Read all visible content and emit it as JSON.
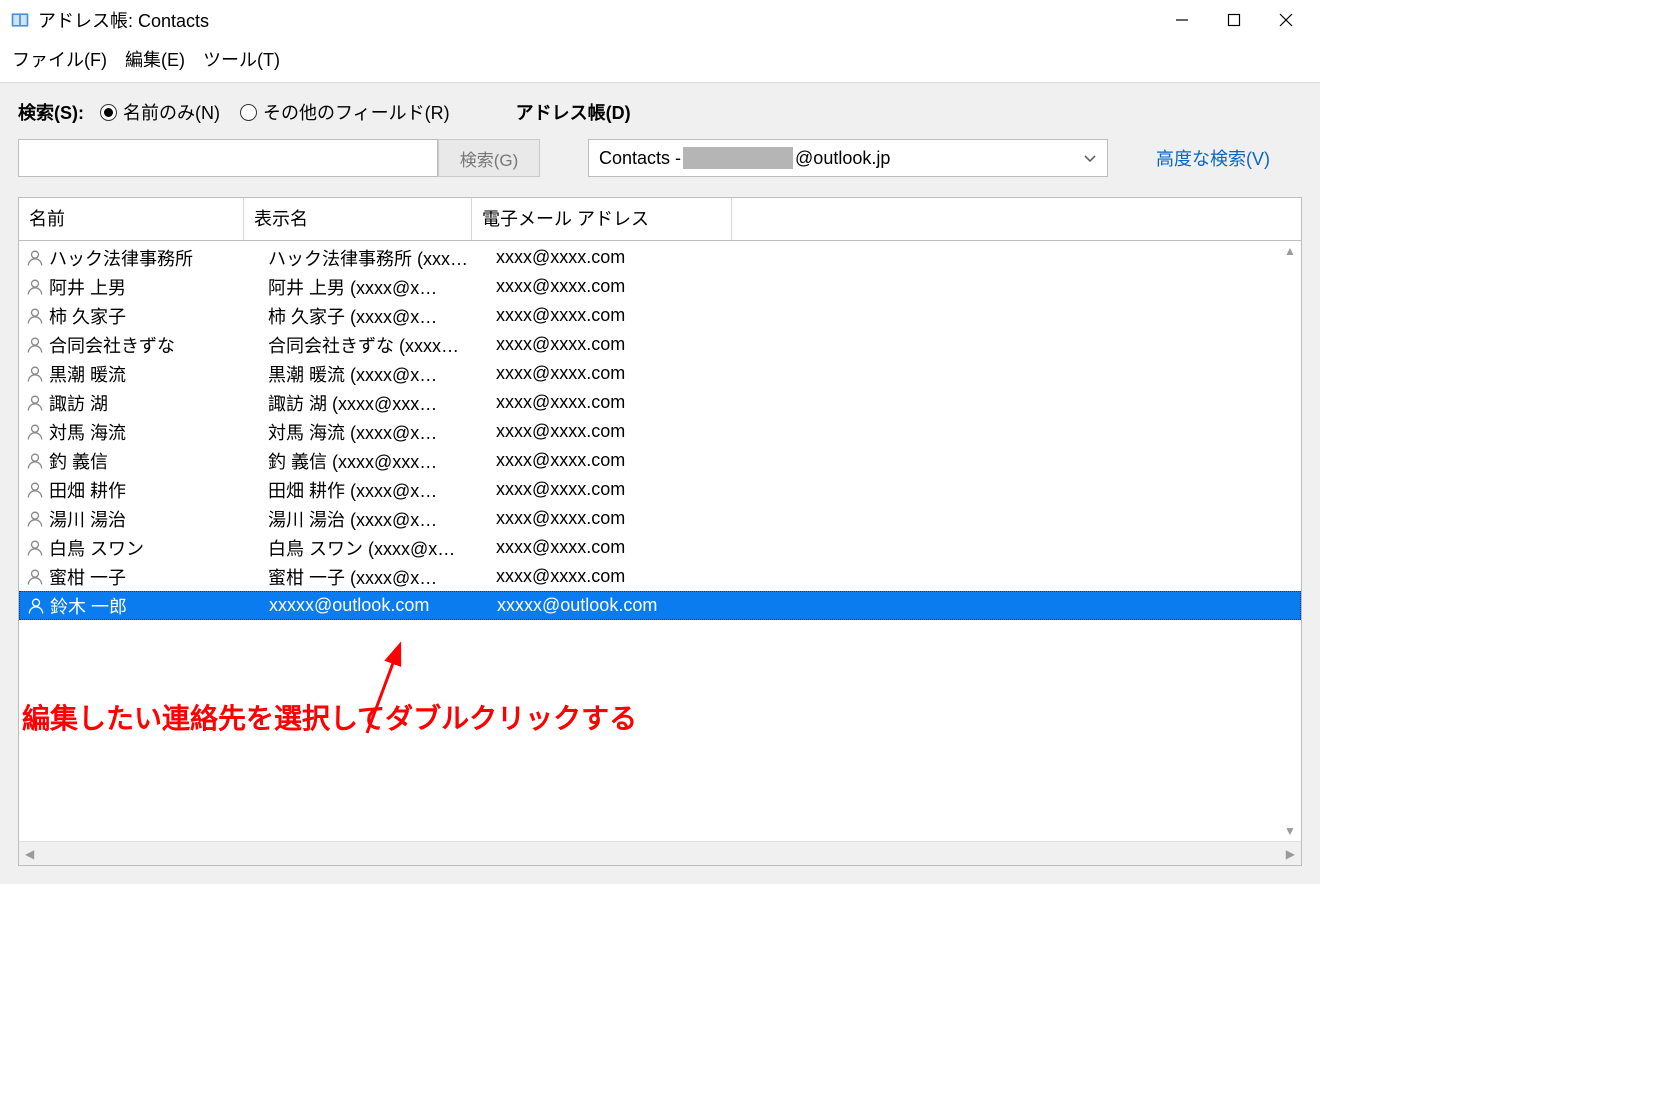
{
  "window": {
    "title": "アドレス帳: Contacts"
  },
  "menu": {
    "file": "ファイル(F)",
    "edit": "編集(E)",
    "tools": "ツール(T)"
  },
  "search": {
    "label": "検索(S):",
    "radio_name_only": "名前のみ(N)",
    "radio_other_fields": "その他のフィールド(R)",
    "button": "検索(G)",
    "input_value": ""
  },
  "address_book": {
    "label": "アドレス帳(D)",
    "select_prefix": "Contacts - ",
    "select_suffix": "@outlook.jp"
  },
  "advanced_link": "高度な検索(V)",
  "columns": {
    "name": "名前",
    "display": "表示名",
    "email": "電子メール アドレス"
  },
  "rows": [
    {
      "name": "ハック法律事務所",
      "display": "ハック法律事務所 (xxx…",
      "email": "xxxx@xxxx.com",
      "selected": false
    },
    {
      "name": "阿井  上男",
      "display": "阿井  上男 (xxxx@x…",
      "email": "xxxx@xxxx.com",
      "selected": false
    },
    {
      "name": "柿  久家子",
      "display": "柿  久家子 (xxxx@x…",
      "email": "xxxx@xxxx.com",
      "selected": false
    },
    {
      "name": "合同会社きずな",
      "display": "合同会社きずな (xxxx…",
      "email": "xxxx@xxxx.com",
      "selected": false
    },
    {
      "name": "黒潮  暖流",
      "display": "黒潮  暖流 (xxxx@x…",
      "email": "xxxx@xxxx.com",
      "selected": false
    },
    {
      "name": "諏訪  湖",
      "display": "諏訪  湖 (xxxx@xxx…",
      "email": "xxxx@xxxx.com",
      "selected": false
    },
    {
      "name": "対馬  海流",
      "display": "対馬  海流 (xxxx@x…",
      "email": "xxxx@xxxx.com",
      "selected": false
    },
    {
      "name": "釣  義信",
      "display": "釣  義信 (xxxx@xxx…",
      "email": "xxxx@xxxx.com",
      "selected": false
    },
    {
      "name": "田畑  耕作",
      "display": "田畑  耕作 (xxxx@x…",
      "email": "xxxx@xxxx.com",
      "selected": false
    },
    {
      "name": "湯川  湯治",
      "display": "湯川  湯治 (xxxx@x…",
      "email": "xxxx@xxxx.com",
      "selected": false
    },
    {
      "name": "白鳥  スワン",
      "display": "白鳥  スワン (xxxx@x…",
      "email": "xxxx@xxxx.com",
      "selected": false
    },
    {
      "name": "蜜柑  一子",
      "display": "蜜柑  一子 (xxxx@x…",
      "email": "xxxx@xxxx.com",
      "selected": false
    },
    {
      "name": "鈴木 一郎",
      "display": "xxxxx@outlook.com",
      "email": "xxxxx@outlook.com",
      "selected": true
    }
  ],
  "annotation": {
    "text": "編集したい連絡先を選択してダブルクリックする"
  }
}
